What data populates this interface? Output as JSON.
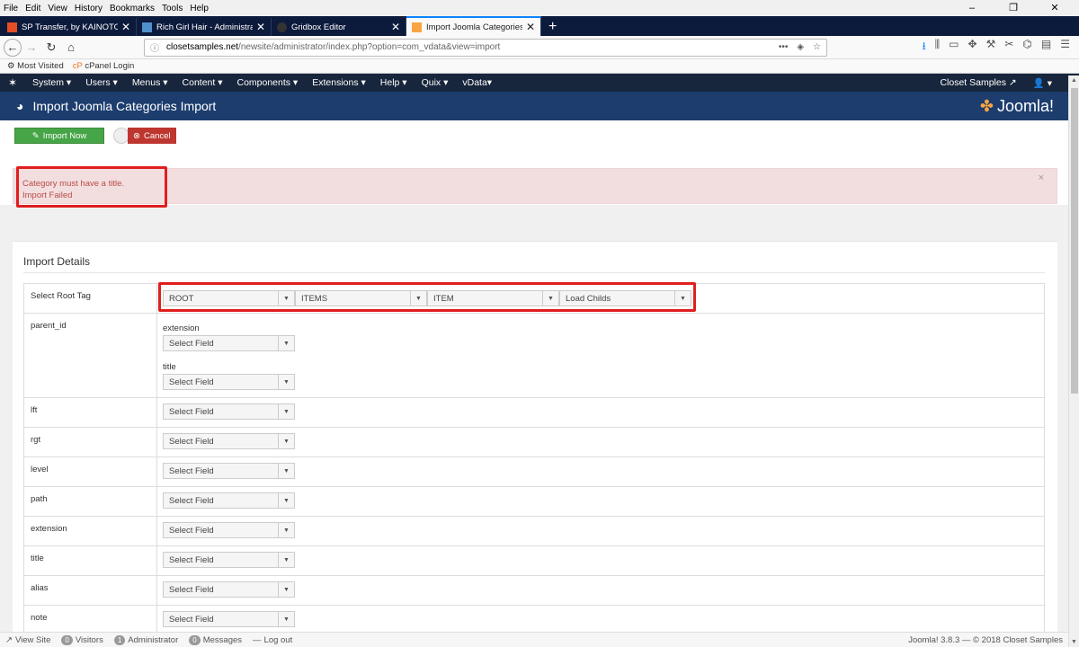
{
  "browser": {
    "menu": [
      "File",
      "Edit",
      "View",
      "History",
      "Bookmarks",
      "Tools",
      "Help"
    ],
    "tabs": [
      {
        "title": "SP Transfer, by KAINOTOMO PH",
        "active": false
      },
      {
        "title": "Rich Girl Hair - Administration",
        "active": false
      },
      {
        "title": "Gridbox Editor",
        "active": false
      },
      {
        "title": "Import Joomla Categories Imp",
        "active": true
      }
    ],
    "url_domain": "closetsamples.net",
    "url_path": "/newsite/administrator/index.php?option=com_vdata&view=import",
    "bookmarks": [
      "Most Visited",
      "cPanel Login"
    ]
  },
  "admin_nav": {
    "items": [
      "System ▾",
      "Users ▾",
      "Menus ▾",
      "Content ▾",
      "Components ▾",
      "Extensions ▾",
      "Help ▾",
      "Quix ▾",
      "vData▾"
    ],
    "site_link": "Closet Samples",
    "user": "▾"
  },
  "header": {
    "title": "Import Joomla Categories Import",
    "brand": "Joomla!"
  },
  "toolbar": {
    "import_label": "Import Now",
    "cancel_label": "Cancel"
  },
  "alert": {
    "line1": "Category must have a title.",
    "line2": "Import Failed",
    "close": "×"
  },
  "details": {
    "heading": "Import Details",
    "root_tag_label": "Select Root Tag",
    "root_tags": [
      "ROOT",
      "ITEMS",
      "ITEM",
      "Load Childs"
    ],
    "parent_id_label": "parent_id",
    "parent_sub": [
      {
        "label": "extension",
        "value": "Select Field"
      },
      {
        "label": "title",
        "value": "Select Field"
      }
    ],
    "fields": [
      {
        "label": "lft",
        "value": "Select Field"
      },
      {
        "label": "rgt",
        "value": "Select Field"
      },
      {
        "label": "level",
        "value": "Select Field"
      },
      {
        "label": "path",
        "value": "Select Field"
      },
      {
        "label": "extension",
        "value": "Select Field"
      },
      {
        "label": "title",
        "value": "Select Field"
      },
      {
        "label": "alias",
        "value": "Select Field"
      },
      {
        "label": "note",
        "value": "Select Field"
      }
    ]
  },
  "status": {
    "view_site": "View Site",
    "visitors_count": "0",
    "visitors": "Visitors",
    "admin_count": "1",
    "admin": "Administrator",
    "messages_count": "0",
    "messages": "Messages",
    "logout": "Log out",
    "version": "Joomla! 3.8.3 — © 2018 Closet Samples"
  }
}
